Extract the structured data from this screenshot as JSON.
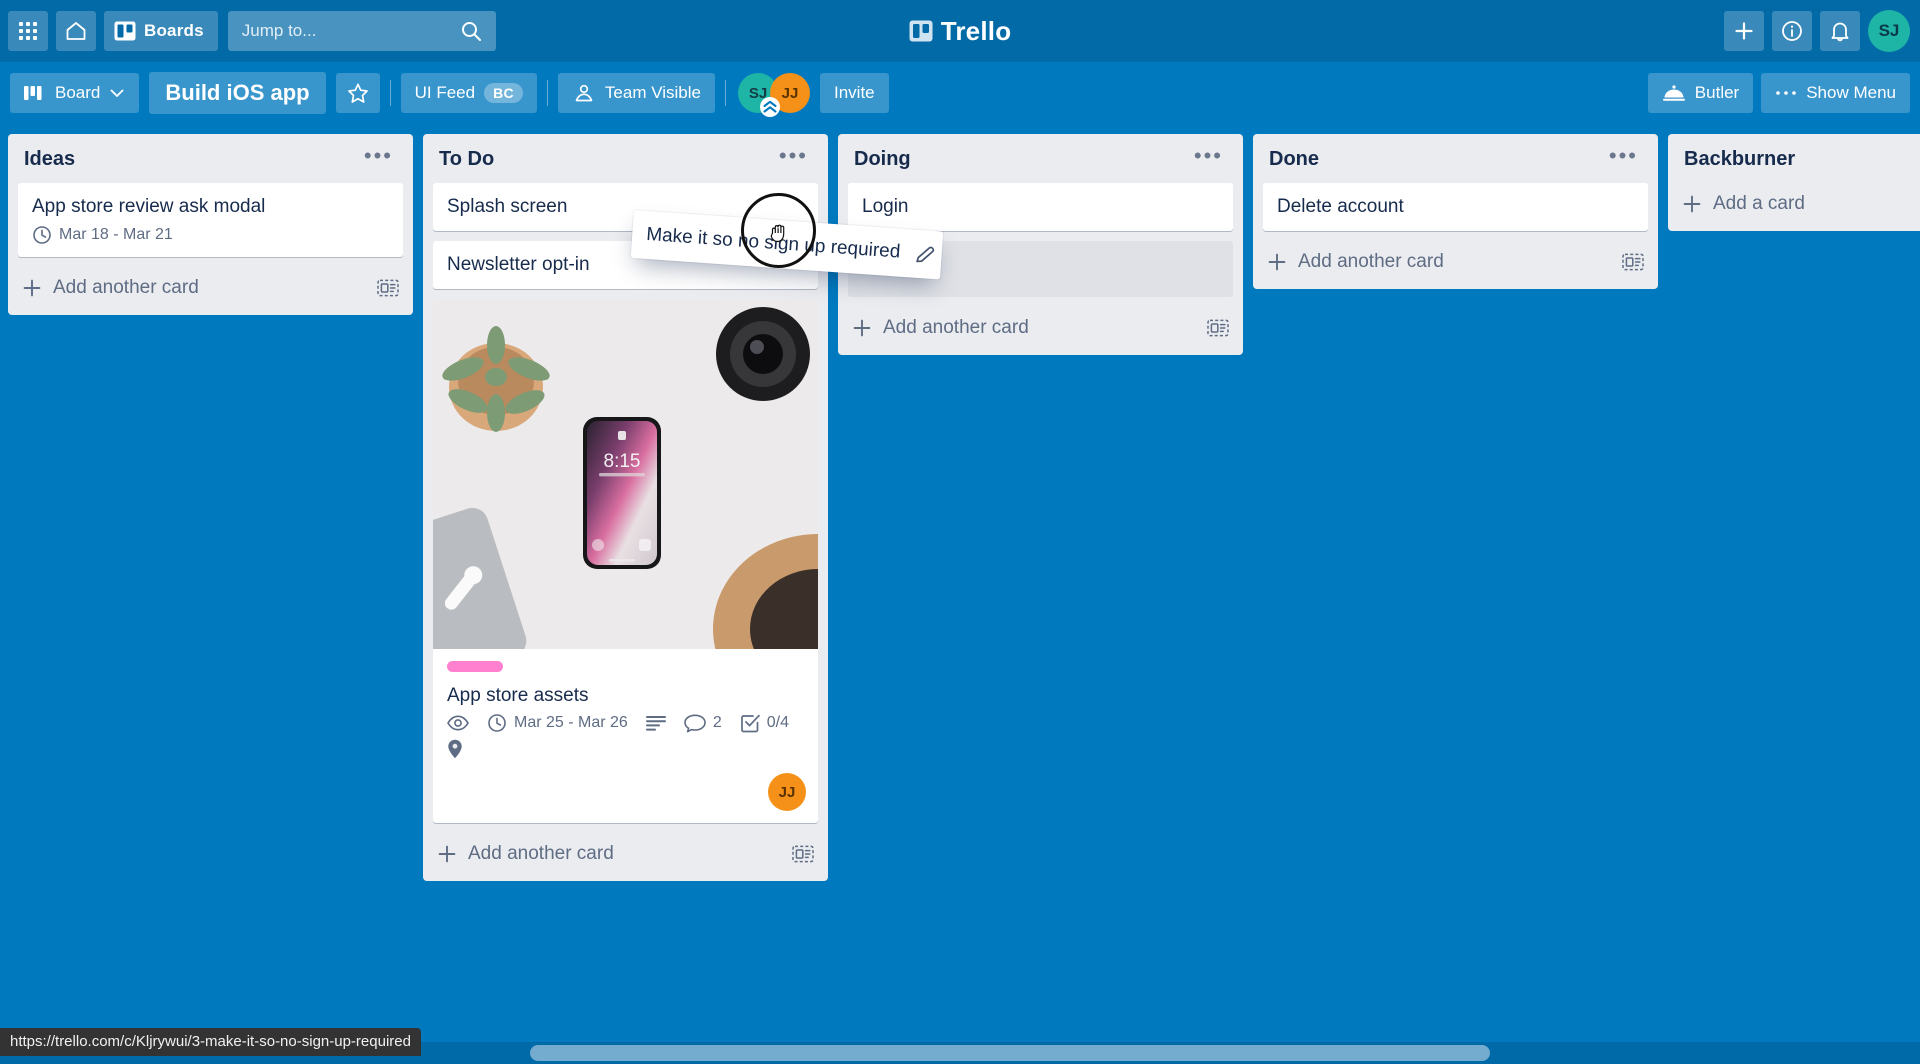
{
  "top_nav": {
    "apps_icon": "grid-apps-icon",
    "home_icon": "home-icon",
    "boards_label": "Boards",
    "boards_icon": "board-icon",
    "search": {
      "placeholder": "Jump to...",
      "value": "",
      "icon": "search-icon"
    },
    "logo_text": "Trello",
    "add_icon": "plus-icon",
    "info_icon": "info-circle-icon",
    "notifications_icon": "bell-icon",
    "avatar_initials": "SJ",
    "avatar_color": "#1eb5a6"
  },
  "board_header": {
    "view_label": "Board",
    "view_icon": "board-view-icon",
    "chevron_icon": "chevron-down-icon",
    "title": "Build iOS app",
    "star_icon": "star-icon",
    "team_label": "UI Feed",
    "team_chip": "BC",
    "visibility_label": "Team Visible",
    "visibility_icon": "people-icon",
    "members": [
      {
        "initials": "SJ",
        "color": "#1eb5a6"
      },
      {
        "initials": "JJ",
        "color": "#f59118"
      }
    ],
    "invite_label": "Invite",
    "butler_label": "Butler",
    "butler_icon": "butler-bell-icon",
    "show_menu_label": "Show Menu",
    "show_menu_icon": "ellipsis-icon"
  },
  "lists": [
    {
      "title": "Ideas",
      "menu_icon": "list-menu-icon",
      "add_card_label": "Add another card",
      "add_card_plus_icon": "plus-icon",
      "template_icon": "card-template-icon",
      "has_template_icon": true,
      "cards": [
        {
          "title": "App store review ask modal",
          "badges": [
            {
              "icon": "clock-icon",
              "text": "Mar 18 - Mar 21"
            }
          ]
        }
      ]
    },
    {
      "title": "To Do",
      "menu_icon": "list-menu-icon",
      "add_card_label": "Add another card",
      "add_card_plus_icon": "plus-icon",
      "template_icon": "card-template-icon",
      "has_template_icon": true,
      "cards": [
        {
          "title": "Splash screen",
          "badges": []
        },
        {
          "title": "Newsletter opt-in",
          "badges": []
        },
        {
          "title": "App store assets",
          "cover": "photo-desk-iphone-succulent",
          "label_color": "#ff80ce",
          "badges": [
            {
              "icon": "eye-icon",
              "text": ""
            },
            {
              "icon": "clock-icon",
              "text": "Mar 25 - Mar 26"
            },
            {
              "icon": "description-icon",
              "text": ""
            },
            {
              "icon": "comment-icon",
              "text": "2"
            },
            {
              "icon": "checklist-icon",
              "text": "0/4"
            },
            {
              "icon": "location-pin-icon",
              "text": ""
            }
          ],
          "avatars": [
            {
              "initials": "JJ",
              "color": "#f59118"
            }
          ]
        }
      ]
    },
    {
      "title": "Doing",
      "menu_icon": "list-menu-icon",
      "add_card_label": "Add another card",
      "add_card_plus_icon": "plus-icon",
      "template_icon": "card-template-icon",
      "has_template_icon": true,
      "cards": [
        {
          "title": "Login",
          "badges": []
        }
      ],
      "drop_placeholder": true
    },
    {
      "title": "Done",
      "menu_icon": "list-menu-icon",
      "add_card_label": "Add another card",
      "add_card_plus_icon": "plus-icon",
      "template_icon": "card-template-icon",
      "has_template_icon": true,
      "cards": [
        {
          "title": "Delete account",
          "badges": []
        }
      ]
    },
    {
      "title": "Backburner",
      "menu_icon": "",
      "add_card_label": "Add a card",
      "add_card_plus_icon": "plus-icon",
      "has_template_icon": false,
      "cards": []
    }
  ],
  "drag": {
    "card_title": "Make it so no sign up required",
    "edit_icon": "pencil-icon",
    "cursor_icon": "grabbing-hand-cursor"
  },
  "status_bar": {
    "url": "https://trello.com/c/Kljrywui/3-make-it-so-no-sign-up-required"
  },
  "colors": {
    "board_background": "#0079bf",
    "nav_background": "#026aa7",
    "list_background": "#ebecf0",
    "card_background": "#ffffff",
    "text_dark": "#172b4d",
    "text_muted": "#5e6c84",
    "label_pink": "#ff80ce"
  }
}
